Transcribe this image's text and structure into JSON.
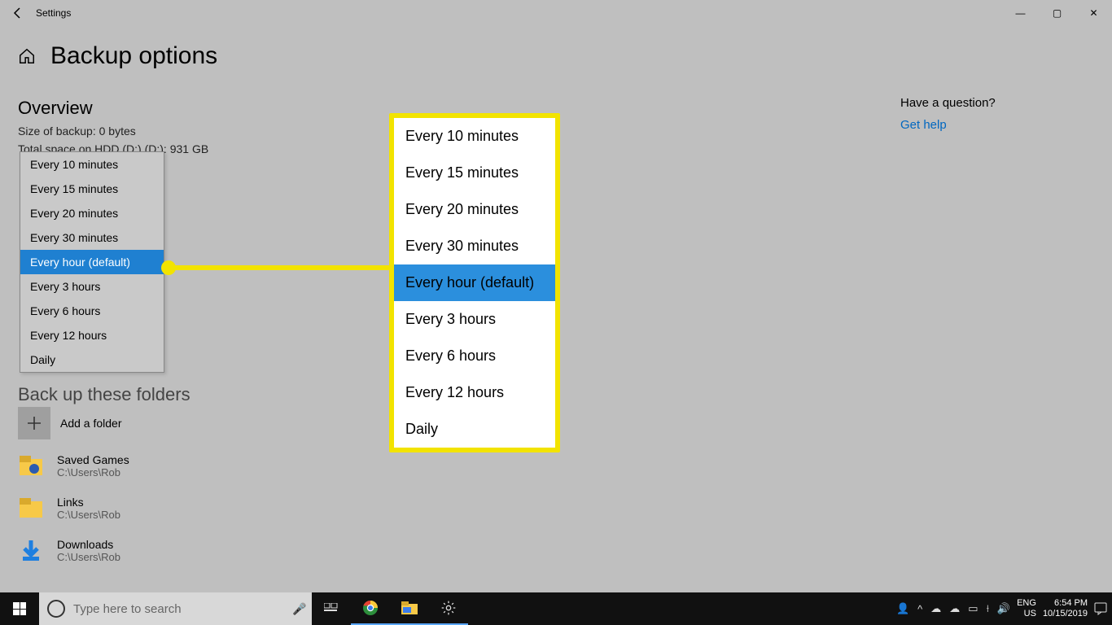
{
  "window": {
    "title": "Settings",
    "page_title": "Backup options",
    "minimize": "—",
    "maximize": "▢",
    "close": "✕"
  },
  "overview": {
    "heading": "Overview",
    "size_line": "Size of backup: 0 bytes",
    "space_line": "Total space on HDD (D:) (D:): 931 GB"
  },
  "dropdown": {
    "items": [
      "Every 10 minutes",
      "Every 15 minutes",
      "Every 20 minutes",
      "Every 30 minutes",
      "Every hour (default)",
      "Every 3 hours",
      "Every 6 hours",
      "Every 12 hours",
      "Daily"
    ],
    "selected_index": 4
  },
  "folders": {
    "heading": "Back up these folders",
    "add_label": "Add a folder",
    "items": [
      {
        "name": "Saved Games",
        "path": "C:\\Users\\Rob"
      },
      {
        "name": "Links",
        "path": "C:\\Users\\Rob"
      },
      {
        "name": "Downloads",
        "path": "C:\\Users\\Rob"
      }
    ]
  },
  "help": {
    "heading": "Have a question?",
    "link": "Get help"
  },
  "taskbar": {
    "search_placeholder": "Type here to search",
    "lang1": "ENG",
    "lang2": "US",
    "time": "6:54 PM",
    "date": "10/15/2019"
  }
}
